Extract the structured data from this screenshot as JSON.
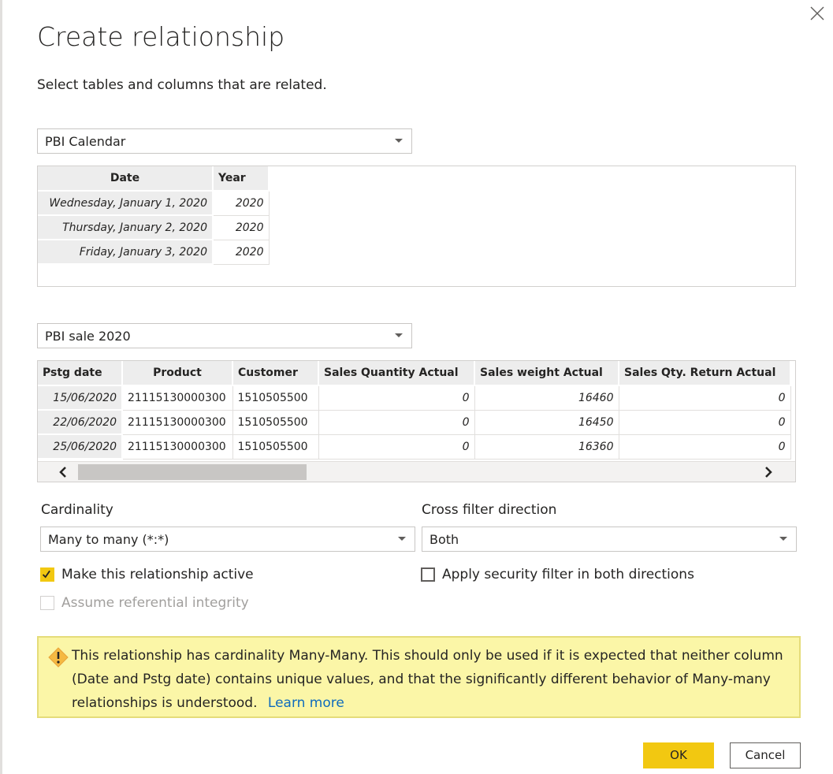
{
  "dialog": {
    "title": "Create relationship",
    "subtitle": "Select tables and columns that are related."
  },
  "table1": {
    "selected": "PBI Calendar",
    "columns": [
      "Date",
      "Year"
    ],
    "rows": [
      [
        "Wednesday, January 1, 2020",
        "2020"
      ],
      [
        "Thursday, January 2, 2020",
        "2020"
      ],
      [
        "Friday, January 3, 2020",
        "2020"
      ]
    ]
  },
  "table2": {
    "selected": "PBI sale 2020",
    "columns": [
      "Pstg date",
      "Product",
      "Customer",
      "Sales Quantity Actual",
      "Sales weight Actual",
      "Sales Qty. Return Actual"
    ],
    "rows": [
      [
        "15/06/2020",
        "21115130000300",
        "1510505500",
        "0",
        "16460",
        "0"
      ],
      [
        "22/06/2020",
        "21115130000300",
        "1510505500",
        "0",
        "16450",
        "0"
      ],
      [
        "25/06/2020",
        "21115130000300",
        "1510505500",
        "0",
        "16360",
        "0"
      ]
    ]
  },
  "cardinality": {
    "label": "Cardinality",
    "value": "Many to many (*:*)"
  },
  "cross_filter": {
    "label": "Cross filter direction",
    "value": "Both"
  },
  "options": {
    "make_active": {
      "label": "Make this relationship active",
      "checked": true
    },
    "referential_integrity": {
      "label": "Assume referential integrity",
      "checked": false,
      "disabled": true
    },
    "security_filter": {
      "label": "Apply security filter in both directions",
      "checked": false
    }
  },
  "warning": {
    "text": "This relationship has cardinality Many-Many. This should only be used if it is expected that neither column (Date and Pstg date) contains unique values, and that the significantly different behavior of Many-many relationships is understood.",
    "link": "Learn more"
  },
  "buttons": {
    "ok": "OK",
    "cancel": "Cancel"
  },
  "colors": {
    "accent": "#f2c811",
    "warning_bg": "#fbf6a7",
    "link": "#0f6cbd"
  }
}
